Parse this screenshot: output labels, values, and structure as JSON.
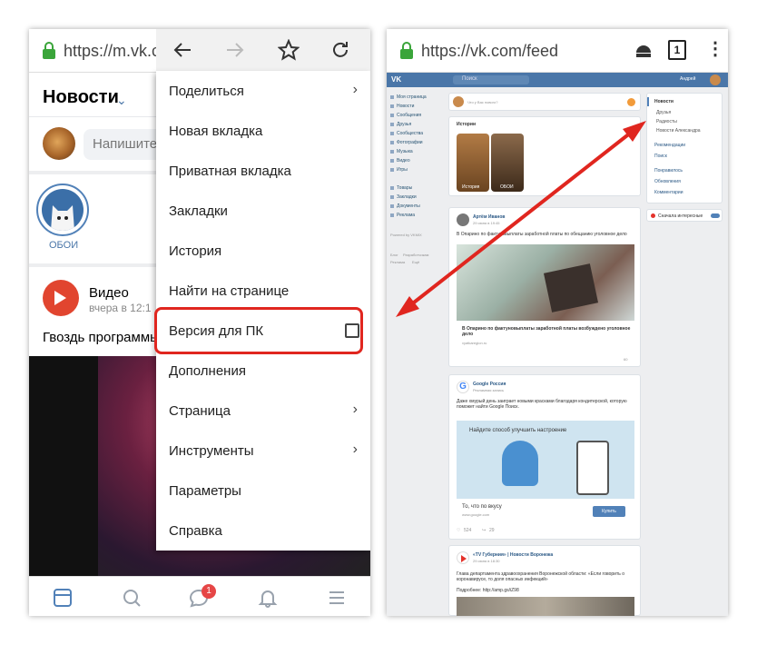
{
  "left": {
    "url": "https://m.vk.co",
    "news_title": "Новости",
    "post_placeholder": "Напишите",
    "story_label": "ОБОИ",
    "video_title": "Видео",
    "video_time": "вчера в 12:1",
    "video_caption": "Гвоздь программы",
    "badge_count": "1",
    "menu": {
      "items": [
        {
          "label": "Поделиться",
          "arrow": true
        },
        {
          "label": "Новая вкладка"
        },
        {
          "label": "Приватная вкладка"
        },
        {
          "label": "Закладки"
        },
        {
          "label": "История"
        },
        {
          "label": "Найти на странице"
        },
        {
          "label": "Версия для ПК",
          "checkbox": true,
          "checked": false
        },
        {
          "label": "Дополнения"
        },
        {
          "label": "Страница",
          "arrow": true
        },
        {
          "label": "Инструменты",
          "arrow": true
        },
        {
          "label": "Параметры"
        },
        {
          "label": "Справка"
        }
      ]
    }
  },
  "right": {
    "url": "https://vk.com/feed",
    "tab_count": "1",
    "vk": {
      "logo": "VK",
      "search_placeholder": "Поиск",
      "user_name": "Андрей",
      "left_nav": [
        "Моя страница",
        "Новости",
        "Сообщения",
        "Друзья",
        "Сообщества",
        "Фотографии",
        "Музыка",
        "Видео",
        "Игры",
        "Товары",
        "Закладки",
        "Документы",
        "Реклама"
      ],
      "left_footer": [
        "Блог",
        "Разработчикам",
        "Реклама",
        "Ещё"
      ],
      "powered": "Powered by VKMIX",
      "composer_placeholder": "Что у Вас нового?",
      "stories_title": "Истории",
      "story1_label": "История",
      "story2_label": "ОБОИ",
      "post1": {
        "author": "Артём Иванов",
        "time": "29 июня в 19:45",
        "text": "В Опарино по фактуновыплаты заработной платы по обещанию уголовное дело",
        "link_title": "В Опарино по фактуновыплаты заработной платы возбуждено уголовное дело",
        "link_domain": "vyatkaregion.ru",
        "views": "60"
      },
      "post2": {
        "author": "Google Россия",
        "time": "Рекламная запись",
        "text": "Даже хмурый день заиграет новыми красками благодаря кондитерской, которую поможет найти Google Поиск.",
        "banner": "Найдите способ улучшить настроение",
        "link_title": "То, что по вкусу",
        "link_domain": "www.google.com",
        "button": "Купить",
        "likes": "524",
        "shares": "29"
      },
      "post3": {
        "author": "«ТV Губерния» | Новости Воронежа",
        "time": "29 июня в 18:30",
        "text": "Глава департамента здравоохранения Воронежской области: «Если говорить о коронавирусе, то доля опасных инфекций»",
        "more": "Подробнее: http://amp.gs/iZ98"
      },
      "right_menu": {
        "title": "Новости",
        "items": [
          "Друзья",
          "Радиосты",
          "Новости Александра",
          "Рекомендации",
          "Поиск",
          "Понравилось",
          "Обновления",
          "Комментарии"
        ],
        "toggle_label": "Сначала интересные"
      }
    }
  }
}
